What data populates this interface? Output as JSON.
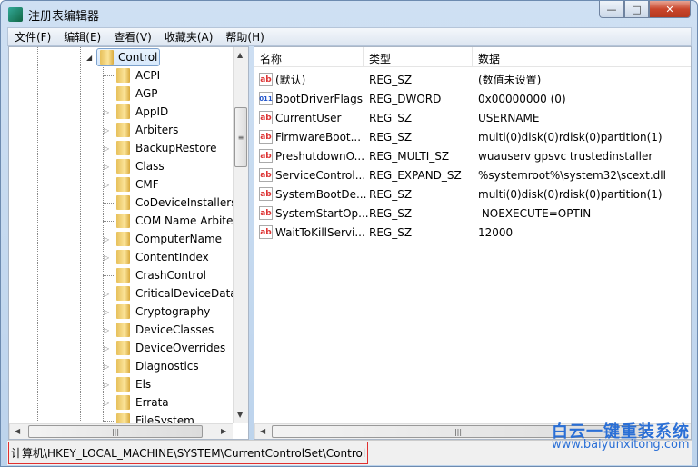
{
  "window": {
    "title": "注册表编辑器",
    "minimize": "—",
    "maximize": "□",
    "close": "✕"
  },
  "menu": [
    "文件(F)",
    "编辑(E)",
    "查看(V)",
    "收藏夹(A)",
    "帮助(H)"
  ],
  "tree": {
    "selected": "Control",
    "items": [
      {
        "label": "ACPI",
        "expandable": false
      },
      {
        "label": "AGP",
        "expandable": false
      },
      {
        "label": "AppID",
        "expandable": true
      },
      {
        "label": "Arbiters",
        "expandable": true
      },
      {
        "label": "BackupRestore",
        "expandable": true
      },
      {
        "label": "Class",
        "expandable": true
      },
      {
        "label": "CMF",
        "expandable": true
      },
      {
        "label": "CoDeviceInstallers",
        "expandable": false
      },
      {
        "label": "COM Name Arbiter",
        "expandable": false
      },
      {
        "label": "ComputerName",
        "expandable": true
      },
      {
        "label": "ContentIndex",
        "expandable": true
      },
      {
        "label": "CrashControl",
        "expandable": false
      },
      {
        "label": "CriticalDeviceDatabase",
        "expandable": true
      },
      {
        "label": "Cryptography",
        "expandable": true
      },
      {
        "label": "DeviceClasses",
        "expandable": true
      },
      {
        "label": "DeviceOverrides",
        "expandable": true
      },
      {
        "label": "Diagnostics",
        "expandable": true
      },
      {
        "label": "Els",
        "expandable": true
      },
      {
        "label": "Errata",
        "expandable": true
      },
      {
        "label": "FileSystem",
        "expandable": false
      }
    ]
  },
  "list": {
    "columns": [
      "名称",
      "类型",
      "数据"
    ],
    "rows": [
      {
        "icon": "string-value-icon",
        "name": "(默认)",
        "type": "REG_SZ",
        "data": "(数值未设置)"
      },
      {
        "icon": "binary-value-icon",
        "name": "BootDriverFlags",
        "type": "REG_DWORD",
        "data": "0x00000000 (0)"
      },
      {
        "icon": "string-value-icon",
        "name": "CurrentUser",
        "type": "REG_SZ",
        "data": "USERNAME"
      },
      {
        "icon": "string-value-icon",
        "name": "FirmwareBoot...",
        "type": "REG_SZ",
        "data": "multi(0)disk(0)rdisk(0)partition(1)"
      },
      {
        "icon": "string-value-icon",
        "name": "PreshutdownO...",
        "type": "REG_MULTI_SZ",
        "data": "wuauserv gpsvc trustedinstaller"
      },
      {
        "icon": "string-value-icon",
        "name": "ServiceControl...",
        "type": "REG_EXPAND_SZ",
        "data": "%systemroot%\\system32\\scext.dll"
      },
      {
        "icon": "string-value-icon",
        "name": "SystemBootDe...",
        "type": "REG_SZ",
        "data": "multi(0)disk(0)rdisk(0)partition(1)"
      },
      {
        "icon": "string-value-icon",
        "name": "SystemStartOp...",
        "type": "REG_SZ",
        "data": " NOEXECUTE=OPTIN"
      },
      {
        "icon": "string-value-icon",
        "name": "WaitToKillServi...",
        "type": "REG_SZ",
        "data": "12000"
      }
    ]
  },
  "status": {
    "path": "计算机\\HKEY_LOCAL_MACHINE\\SYSTEM\\CurrentControlSet\\Control"
  },
  "watermark": {
    "title": "白云一键重装系统",
    "url": "www.baiyunxitong.com"
  },
  "colors": {
    "accent": "#2a6fd6",
    "close": "#c9462c",
    "highlight": "#e03030"
  }
}
